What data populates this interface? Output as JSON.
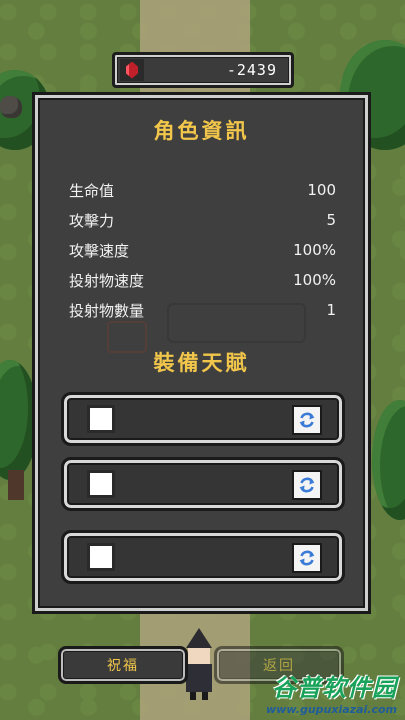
{
  "currency": {
    "icon": "ruby-gem-icon",
    "value": "-2439"
  },
  "panel": {
    "title": "角色資訊",
    "stats": [
      {
        "label": "生命值",
        "value": "100"
      },
      {
        "label": "攻擊力",
        "value": "5"
      },
      {
        "label": "攻擊速度",
        "value": "100%"
      },
      {
        "label": "投射物速度",
        "value": "100%"
      },
      {
        "label": "投射物數量",
        "value": "1"
      }
    ],
    "talents_title": "裝備天賦",
    "talent_slots": [
      {
        "refresh_icon": "refresh-icon"
      },
      {
        "refresh_icon": "refresh-icon"
      },
      {
        "refresh_icon": "refresh-icon"
      }
    ]
  },
  "bottom": {
    "bless_label": "祝福",
    "back_label": "返回"
  },
  "watermark": {
    "title": "谷普软件园",
    "url": "www.gupuxiazai.com"
  },
  "colors": {
    "accent_gold": "#f1c64b",
    "panel_bg": "#3f3f3f",
    "gem_red": "#c0202a",
    "refresh_blue": "#3a7bd5"
  }
}
